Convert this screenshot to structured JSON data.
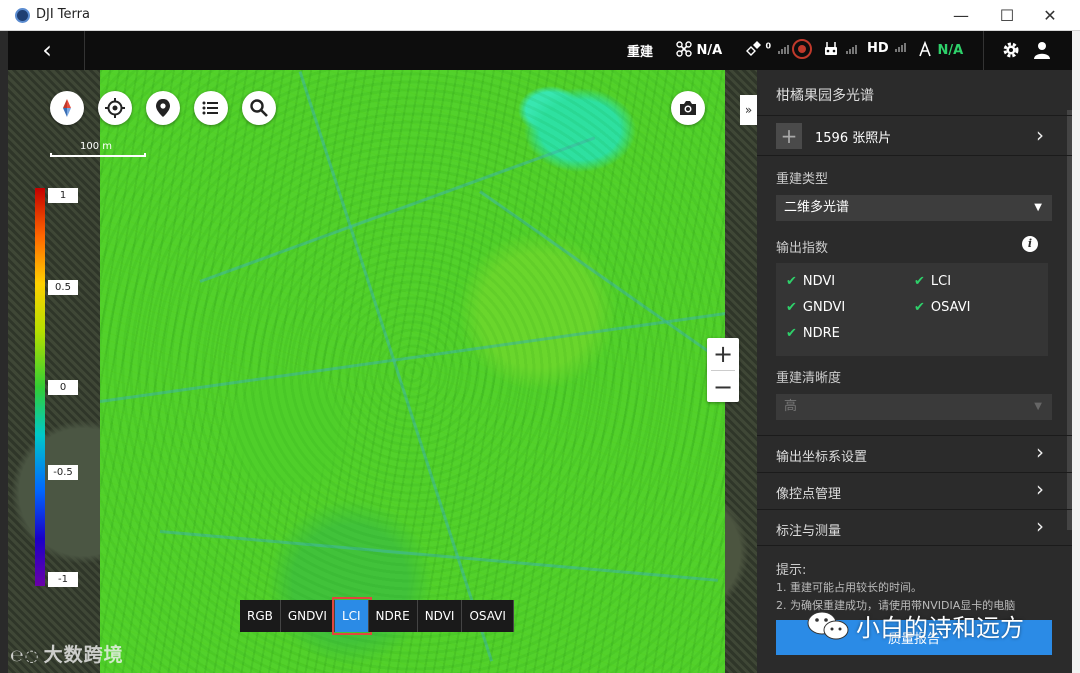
{
  "window": {
    "title": "DJI Terra",
    "minimize": "—",
    "maximize": "☐",
    "close": "✕"
  },
  "toolbar": {
    "back": "‹",
    "rebuild": "重建",
    "drone_status": "N/A",
    "gps_status": "0",
    "hd": "HD",
    "rtk_status": "N/A"
  },
  "map": {
    "scale_text": "100 m",
    "legend": [
      "1",
      "0.5",
      "0",
      "-0.5",
      "-1"
    ],
    "zoom_in": "+",
    "zoom_out": "−",
    "collapse": "»",
    "index_buttons": [
      "RGB",
      "GNDVI",
      "LCI",
      "NDRE",
      "NDVI",
      "OSAVI"
    ],
    "active_index": "LCI",
    "watermark_left": "大数跨境"
  },
  "panel": {
    "title": "柑橘果园多光谱",
    "photos": "1596 张照片",
    "plus": "+",
    "recon_type_label": "重建类型",
    "recon_type_value": "二维多光谱",
    "output_index_label": "输出指数",
    "info": "i",
    "indices": [
      {
        "name": "NDVI",
        "checked": true
      },
      {
        "name": "LCI",
        "checked": true
      },
      {
        "name": "GNDVI",
        "checked": true
      },
      {
        "name": "OSAVI",
        "checked": true
      },
      {
        "name": "NDRE",
        "checked": true
      }
    ],
    "resolution_label": "重建清晰度",
    "resolution_value": "高",
    "coord_settings": "输出坐标系设置",
    "gcp_manage": "像控点管理",
    "annotation": "标注与测量",
    "tips_title": "提示:",
    "tips": [
      "1. 重建可能占用较长的时间。",
      "2. 为确保重建成功，请使用带NVIDIA显卡的电脑"
    ],
    "report_button": "质量报告"
  },
  "wechat_watermark": "小白的诗和远方",
  "colors": {
    "accent_blue": "#2b8be6",
    "check_green": "#2ed16a",
    "panel_bg": "#2b2b2b",
    "toolbar_bg": "#0d0d0d"
  }
}
